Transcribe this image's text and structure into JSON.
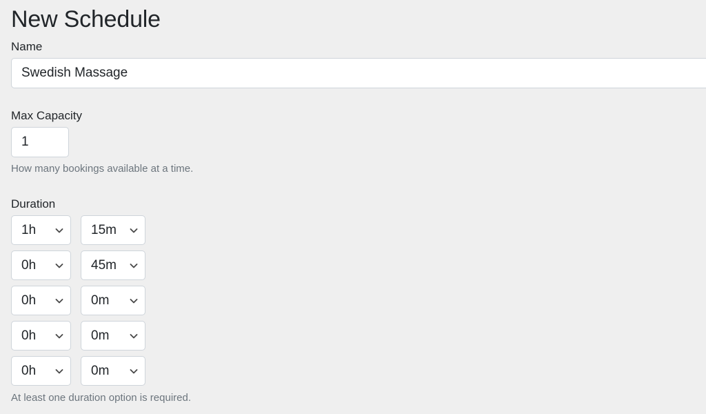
{
  "page": {
    "title": "New Schedule"
  },
  "form": {
    "name_field": {
      "label": "Name",
      "value": "Swedish Massage",
      "placeholder": ""
    },
    "capacity_field": {
      "label": "Max Capacity",
      "value": "1",
      "placeholder": "",
      "help": "How many bookings available at a time."
    },
    "duration_field": {
      "label": "Duration",
      "help": "At least one duration option is required.",
      "rows": [
        {
          "hours": "1h",
          "minutes": "15m"
        },
        {
          "hours": "0h",
          "minutes": "45m"
        },
        {
          "hours": "0h",
          "minutes": "0m"
        },
        {
          "hours": "0h",
          "minutes": "0m"
        },
        {
          "hours": "0h",
          "minutes": "0m"
        }
      ]
    }
  },
  "icons": {
    "chevron": "chevron-down-icon"
  },
  "colors": {
    "background": "#efefef",
    "field_background": "#ffffff",
    "border": "#ced4da",
    "text": "#212529",
    "muted_text": "#6c757d"
  }
}
